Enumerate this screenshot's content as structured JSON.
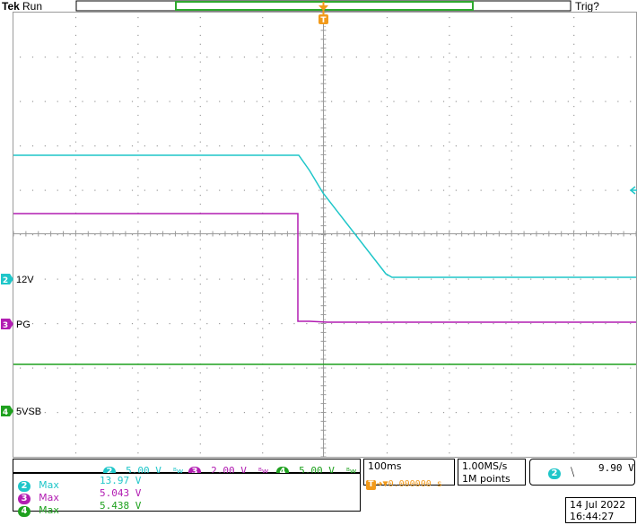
{
  "header": {
    "brand": "Tek",
    "run_state": "Run",
    "trig_state": "Trig?",
    "trigger_marker": "T"
  },
  "colors": {
    "ch2": "#1fc6c9",
    "ch3": "#b21db2",
    "ch4": "#1fa11f",
    "trigger": "#f29a1a",
    "grid": "#9a9a9a",
    "record_bar": "#2ea82e"
  },
  "channels": {
    "ch2": {
      "number": "2",
      "label": "12V",
      "scale": "5.00 V",
      "bw_icon": "bw-limit-icon"
    },
    "ch3": {
      "number": "3",
      "label": "PG",
      "scale": "2.00 V",
      "bw_icon": "bw-limit-icon"
    },
    "ch4": {
      "number": "4",
      "label": "5VSB",
      "scale": "5.00 V",
      "bw_icon": "bw-limit-icon"
    }
  },
  "timebase": {
    "scale": "100ms",
    "position_marker": "T",
    "position": "▼0.000000 s",
    "sample_rate": "1.00MS/s",
    "record_length": "1M points"
  },
  "trigger": {
    "source": "2",
    "slope_icon": "falling-edge-icon",
    "slope_glyph": "⧹",
    "level": "9.90 V"
  },
  "measurements": [
    {
      "channel": "2",
      "name": "Max",
      "value": "13.97 V"
    },
    {
      "channel": "3",
      "name": "Max",
      "value": "5.043 V"
    },
    {
      "channel": "4",
      "name": "Max",
      "value": "5.438 V"
    }
  ],
  "datetime": {
    "date": "14 Jul  2022",
    "time": "16:44:27"
  },
  "traces": {
    "ch2": {
      "high_level": "13.97 V",
      "low_level": "",
      "shape": "ramp-down"
    },
    "ch3": {
      "shape": "step-down"
    },
    "ch4": {
      "shape": "flat"
    }
  }
}
